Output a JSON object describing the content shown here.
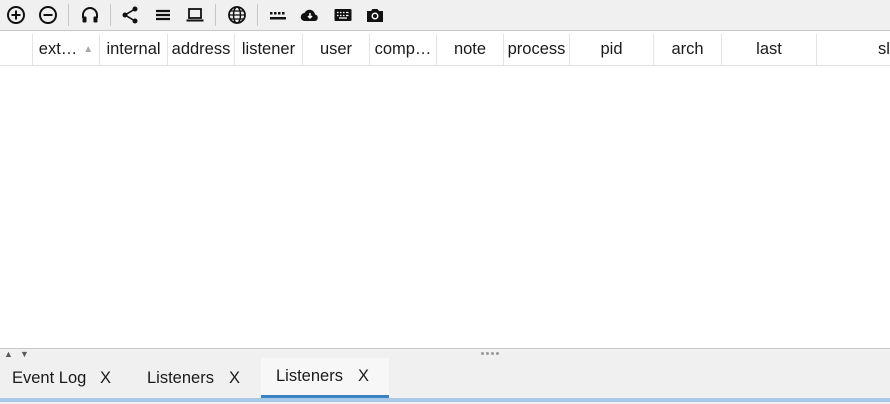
{
  "toolbar": {
    "buttons": [
      {
        "icon": "plus-circle-icon"
      },
      {
        "icon": "minus-circle-icon"
      },
      {
        "icon": "headphones-icon"
      },
      {
        "icon": "share-icon"
      },
      {
        "icon": "hamburger-list-icon"
      },
      {
        "icon": "laptop-icon"
      },
      {
        "icon": "globe-icon"
      },
      {
        "icon": "dots-bar-icon"
      },
      {
        "icon": "cloud-icon"
      },
      {
        "icon": "keyboard-icon"
      },
      {
        "icon": "camera-icon"
      }
    ]
  },
  "table": {
    "columns": [
      "ext…",
      "internal",
      "address",
      "listener",
      "user",
      "comp…",
      "note",
      "process",
      "pid",
      "arch",
      "last",
      "sl"
    ],
    "sorted_column": "ext…",
    "sort_direction": "ascending",
    "rows": []
  },
  "tabs": [
    {
      "label": "Event Log",
      "close": "X",
      "active": false
    },
    {
      "label": "Listeners",
      "close": "X",
      "active": false
    },
    {
      "label": "Listeners",
      "close": "X",
      "active": true
    }
  ],
  "colors": {
    "toolbar_bg": "#f0f0f0",
    "accent": "#3b82c4",
    "accent_light": "#a9c9e8"
  }
}
